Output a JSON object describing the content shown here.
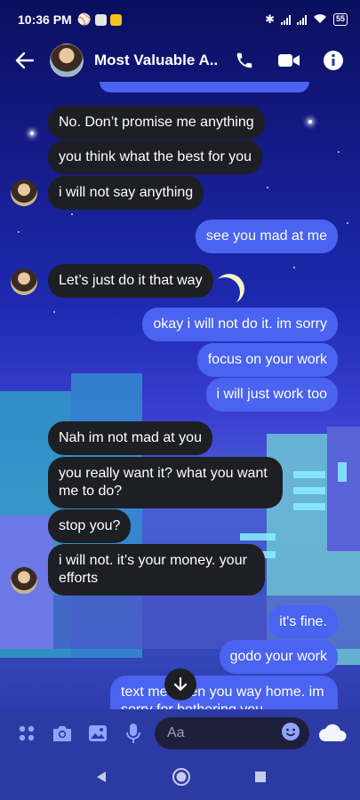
{
  "status_bar": {
    "time": "10:36 PM",
    "battery": "55"
  },
  "header": {
    "title": "Most Valuable A...",
    "icons": [
      "back-arrow-icon",
      "phone-icon",
      "video-icon",
      "info-icon"
    ]
  },
  "messages": [
    {
      "side": "in",
      "text": "No. Don’t promise me anything"
    },
    {
      "side": "in",
      "text": "you think what the best for you"
    },
    {
      "side": "in",
      "text": "i will not say anything"
    },
    {
      "side": "out",
      "text": "see you mad at me"
    },
    {
      "side": "in",
      "text": "Let’s just do it that way"
    },
    {
      "side": "out",
      "text": "okay i will not do it. im sorry"
    },
    {
      "side": "out",
      "text": "focus on your work"
    },
    {
      "side": "out",
      "text": "i will just work too"
    },
    {
      "side": "in",
      "text": "Nah im not mad at you"
    },
    {
      "side": "in",
      "text": "you really want it? what you want me to do?"
    },
    {
      "side": "in",
      "text": "stop you?"
    },
    {
      "side": "in",
      "text": "i will not. it’s your money. your efforts"
    },
    {
      "side": "out",
      "text": "it's fine."
    },
    {
      "side": "out",
      "text": "godo your work"
    },
    {
      "side": "out",
      "text": "text me when you way home. im sorry for bothering you"
    }
  ],
  "composer": {
    "placeholder": "Aa",
    "icons": [
      "apps-icon",
      "camera-icon",
      "gallery-icon",
      "microphone-icon",
      "emoji-icon",
      "cloud-icon"
    ]
  },
  "colors": {
    "incoming_bubble": "#1e1f24",
    "outgoing_bubble": "#4a63f0"
  }
}
